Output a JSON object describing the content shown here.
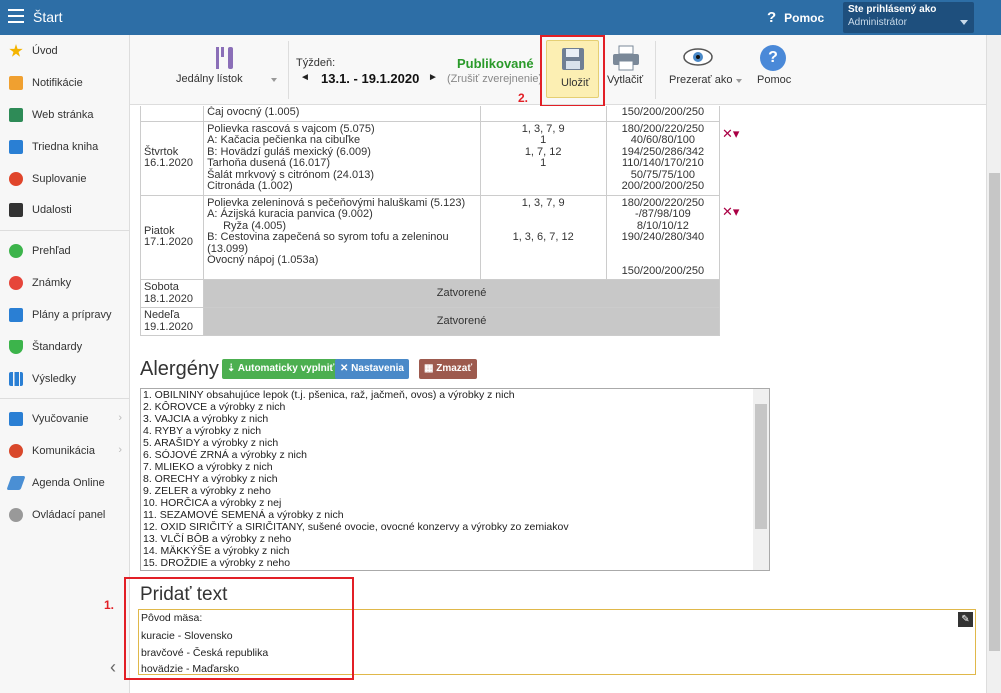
{
  "topbar": {
    "title": "Štart",
    "help": "Pomoc",
    "user_line1": "Ste prihlásený ako",
    "user_line2": "Administrátor"
  },
  "sidebar": {
    "items": [
      {
        "label": "Úvod",
        "icon": "star-icon"
      },
      {
        "label": "Notifikácie",
        "icon": "envelope-icon"
      },
      {
        "label": "Web stránka",
        "icon": "home-icon"
      },
      {
        "label": "Triedna kniha",
        "icon": "book-icon"
      },
      {
        "label": "Suplovanie",
        "icon": "person-icon"
      },
      {
        "label": "Udalosti",
        "icon": "calendar-icon"
      },
      {
        "label": "Prehľad",
        "icon": "check-circle-icon"
      },
      {
        "label": "Známky",
        "icon": "grade-icon"
      },
      {
        "label": "Plány a prípravy",
        "icon": "briefcase-icon"
      },
      {
        "label": "Štandardy",
        "icon": "shield-icon"
      },
      {
        "label": "Výsledky",
        "icon": "bar-chart-icon"
      },
      {
        "label": "Vyučovanie",
        "icon": "layers-icon"
      },
      {
        "label": "Komunikácia",
        "icon": "chat-icon"
      },
      {
        "label": "Agenda Online",
        "icon": "pen-icon"
      },
      {
        "label": "Ovládací panel",
        "icon": "gear-icon"
      }
    ]
  },
  "toolbar": {
    "menu_label": "Jedálny lístok",
    "week_label": "Týždeň:",
    "week_range": "13.1. - 19.1.2020",
    "prev": "◄",
    "next": "►",
    "published": "Publikované",
    "unpublish": "(Zrušiť zverejnenie)",
    "save": "Uložiť",
    "print": "Vytlačiť",
    "view_as": "Prezerať ako",
    "help": "Pomoc"
  },
  "annotations": {
    "n1": "1.",
    "n2": "2."
  },
  "menu_rows": [
    {
      "day": "",
      "meals": [
        "Čaj ovocný (1.005)"
      ],
      "allergens": [
        ""
      ],
      "portions": [
        "150/200/200/250"
      ]
    },
    {
      "day": "Štvrtok 16.1.2020",
      "meals": [
        "Polievka rascová s vajcom (5.075)",
        "A: Kačacia pečienka na cibuľke",
        "B: Hovädzí guláš mexický (6.009)",
        "Tarhoňa dusená (16.017)",
        "Šalát mrkvový s citrónom (24.013)",
        "Citronáda (1.002)"
      ],
      "allergens": [
        "1, 3, 7, 9",
        "1",
        "1, 7, 12",
        "1",
        "",
        ""
      ],
      "portions": [
        "180/200/220/250",
        "40/60/80/100",
        "194/250/286/342",
        "110/140/170/210",
        "50/75/75/100",
        "200/200/200/250"
      ]
    },
    {
      "day": "Piatok 17.1.2020",
      "meals": [
        "Polievka zeleninová s pečeňovými haluškami (5.123)",
        "A: Ázijská kuracia panvica (9.002)",
        "    Ryža (4.005)",
        "B: Cestovina zapečená so syrom tofu a zeleninou",
        "(13.099)",
        "Ovocný nápoj (1.053a)"
      ],
      "allergens": [
        "1, 3, 7, 9",
        "",
        "",
        "1, 3, 6, 7, 12",
        "",
        ""
      ],
      "portions": [
        "180/200/220/250",
        "-/87/98/109",
        "8/10/10/12",
        "190/240/280/340",
        "",
        "150/200/200/250"
      ]
    },
    {
      "day": "Sobota 18.1.2020",
      "closed": "Zatvorené"
    },
    {
      "day": "Nedeľa 19.1.2020",
      "closed": "Zatvorené"
    }
  ],
  "allergens_section": {
    "title": "Alergény",
    "btn_autofill": "⇣ Automaticky vyplniť",
    "btn_settings": "Nastavenia",
    "btn_delete": "Zmazať",
    "lines": [
      "1. OBILNINY obsahujúce lepok (t.j. pšenica, raž, jačmeň, ovos) a výrobky z nich",
      "2. KÔROVCE a výrobky z nich",
      "3. VAJCIA a výrobky z nich",
      "4. RYBY a výrobky z nich",
      "5. ARAŠIDY a výrobky z nich",
      "6. SÓJOVÉ ZRNÁ a výrobky z nich",
      "7. MLIEKO a výrobky z nich",
      "8. ORECHY a výrobky z nich",
      "9. ZELER a výrobky z neho",
      "10. HORČICA a výrobky z nej",
      "11. SEZAMOVÉ SEMENÁ a výrobky z nich",
      "12. OXID SIRIČITÝ a SIRIČITANY, sušené ovocie, ovocné konzervy a výrobky zo zemiakov",
      "13. VLČÍ BÔB a výrobky z neho",
      "14. MÄKKÝŠE a výrobky z nich",
      "15. DROŽDIE a výrobky z neho"
    ]
  },
  "add_text": {
    "title": "Pridať text",
    "lines": [
      "Pôvod mäsa:",
      "kuracie - Slovensko",
      "bravčové - Česká republika",
      "hovädzie - Maďarsko"
    ]
  }
}
